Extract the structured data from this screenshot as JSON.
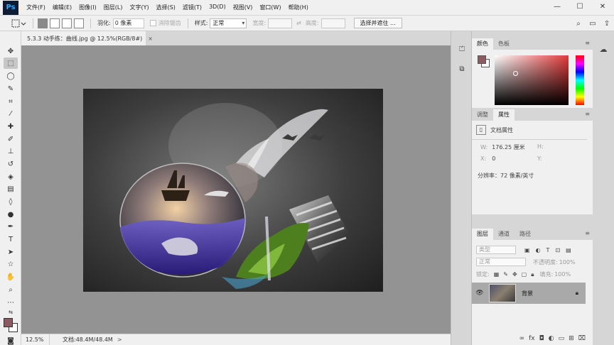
{
  "app": {
    "logo": "Ps"
  },
  "menu": [
    "文件(F)",
    "编辑(E)",
    "图像(I)",
    "图层(L)",
    "文字(Y)",
    "选择(S)",
    "滤镜(T)",
    "3D(D)",
    "视图(V)",
    "窗口(W)",
    "帮助(H)"
  ],
  "window_controls": {
    "minimize": "—",
    "maximize": "☐",
    "close": "✕"
  },
  "options": {
    "feather_label": "羽化:",
    "feather_value": "0 像素",
    "antialias_label": "消除锯齿",
    "style_label": "样式:",
    "style_value": "正常",
    "width_label": "宽度:",
    "height_label": "高度:",
    "select_mask_button": "选择并遮住 ..."
  },
  "document": {
    "tab_title": "5.3.3 动手练：曲线.jpg @ 12.5%(RGB/8#)",
    "tab_close": "×",
    "zoom": "12.5%",
    "doc_size": "文档:48.4M/48.4M",
    "status_arrow": ">"
  },
  "colors": {
    "foreground": "#8c5a60",
    "background": "#ffffff"
  },
  "color_panel": {
    "tabs": [
      "颜色",
      "色板"
    ],
    "active_tab": 0
  },
  "properties_panel": {
    "tabs": [
      "调整",
      "属性"
    ],
    "active_tab": 1,
    "title": "文档属性",
    "w_label": "W:",
    "w_value": "176.25 厘米",
    "h_label": "H:",
    "x_label": "X:",
    "x_value": "0",
    "y_label": "Y:",
    "resolution": "分辨率：72 像素/英寸"
  },
  "layers_panel": {
    "tabs": [
      "图层",
      "通道",
      "路径"
    ],
    "active_tab": 0,
    "filter_kind": "类型",
    "blend_mode": "正常",
    "opacity_label": "不透明度:",
    "opacity_value": "100%",
    "lock_label": "锁定:",
    "fill_label": "填充:",
    "fill_value": "100%",
    "layers": [
      {
        "name": "背景",
        "visible": true,
        "locked": true
      }
    ],
    "footer_icons": [
      "link-icon",
      "fx-icon",
      "mask-icon",
      "adjustment-icon",
      "group-icon",
      "new-layer-icon",
      "trash-icon"
    ]
  }
}
